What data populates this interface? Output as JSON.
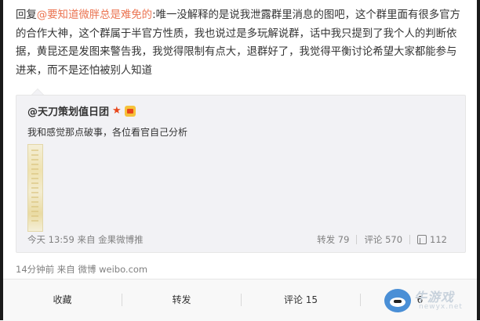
{
  "post": {
    "reply_prefix": "回复",
    "mention": "@要知道微胖总是难免的",
    "text": ":唯一没解释的是说我泄露群里消息的图吧，这个群里面有很多官方的合作大神，这个群属于半官方性质，我也说过是多玩解说群，话中我只提到了我个人的判断依据，黄昆还是发图来警告我，我觉得限制有点大，退群好了，我觉得平衡讨论希望大家都能参与进来，而不是还怕被别人知道"
  },
  "quote": {
    "author": "@天刀策划值日团",
    "text": "我和感觉那点破事，各位看官自己分析",
    "meta": "今天 13:59 来自 金果微博推",
    "actions": {
      "repost": "转发 79",
      "comment": "评论 570",
      "like": "112"
    }
  },
  "post_meta": "14分钟前 来自 微博 weibo.com",
  "bottom_bar": {
    "favorite": "收藏",
    "repost": "转发",
    "comment": "评论 15",
    "like": "6"
  },
  "watermark": {
    "cn": "牛游戏",
    "en": "newyx.net"
  },
  "icons": {
    "verified": "star-icon",
    "member": "crown-icon",
    "like": "thumbs-up-icon",
    "watermark": "cow-mascot-icon"
  },
  "colors": {
    "mention": "#eb7350",
    "verified": "#e8461a",
    "meta_gray": "#808080"
  }
}
